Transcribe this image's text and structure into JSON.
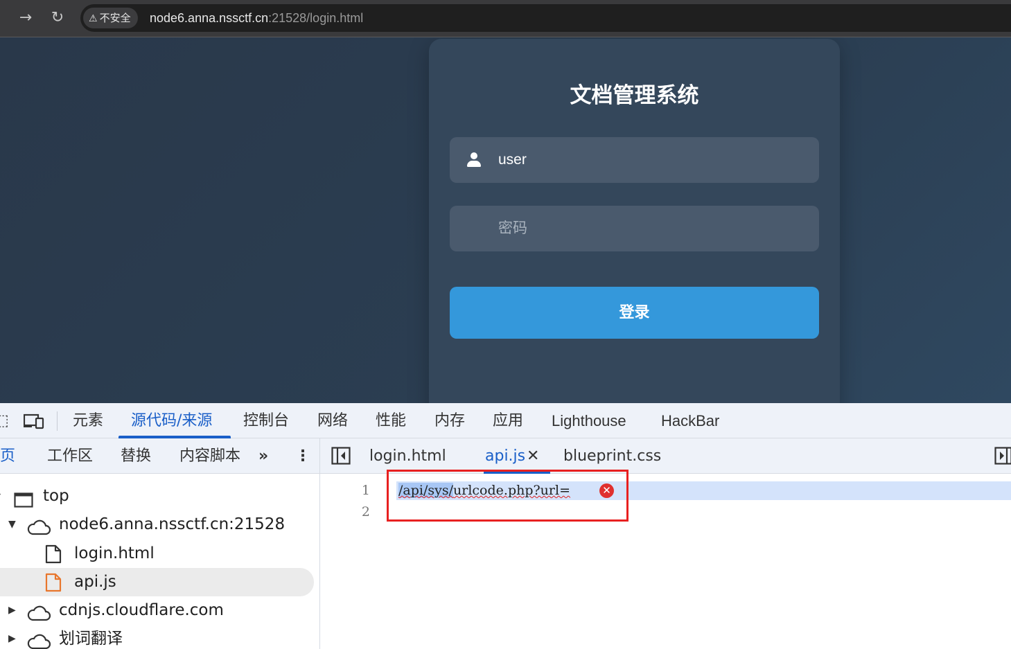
{
  "browser": {
    "security_label": "不安全",
    "url_host": "node6.anna.nssctf.cn",
    "url_path": ":21528/login.html"
  },
  "page": {
    "title": "文档管理系统",
    "username_value": "user",
    "password_placeholder": "密码",
    "login_label": "登录"
  },
  "devtools": {
    "tabs": [
      "元素",
      "源代码/来源",
      "控制台",
      "网络",
      "性能",
      "内存",
      "应用",
      "Lighthouse",
      "HackBar"
    ],
    "active_tab": "源代码/来源",
    "sub_tabs": [
      "网页",
      "工作区",
      "替换",
      "内容脚本"
    ],
    "tree": {
      "top": "top",
      "host": "node6.anna.nssctf.cn:21528",
      "file1": "login.html",
      "file2": "api.js",
      "cdn": "cdnjs.cloudflare.com",
      "ext": "划词翻译"
    },
    "file_tabs": [
      "login.html",
      "api.js",
      "blueprint.css"
    ],
    "active_file": "api.js",
    "editor": {
      "line_numbers": [
        "1",
        "2"
      ],
      "code_sel": "/api/sys/",
      "code_rest": "urlcode.php?url="
    }
  }
}
